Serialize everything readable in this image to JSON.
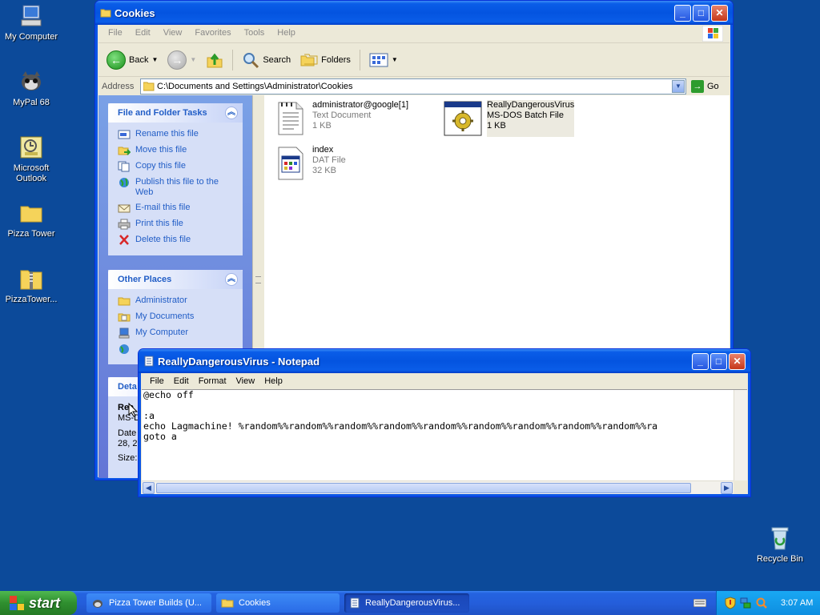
{
  "desktop": {
    "icons": [
      {
        "label": "My Computer"
      },
      {
        "label": "MyPal 68"
      },
      {
        "label": "Microsoft Outlook"
      },
      {
        "label": "Pizza Tower"
      },
      {
        "label": "PizzaTower..."
      },
      {
        "label": "Recycle Bin"
      }
    ]
  },
  "explorer": {
    "title": "Cookies",
    "menu": [
      "File",
      "Edit",
      "View",
      "Favorites",
      "Tools",
      "Help"
    ],
    "toolbar": {
      "back": "Back",
      "search": "Search",
      "folders": "Folders"
    },
    "address": {
      "label": "Address",
      "value": "C:\\Documents and Settings\\Administrator\\Cookies",
      "go": "Go"
    },
    "tasks": {
      "title": "File and Folder Tasks",
      "items": [
        "Rename this file",
        "Move this file",
        "Copy this file",
        "Publish this file to the Web",
        "E-mail this file",
        "Print this file",
        "Delete this file"
      ]
    },
    "places": {
      "title": "Other Places",
      "items": [
        "Administrator",
        "My Documents",
        "My Computer"
      ]
    },
    "details": {
      "title": "Deta",
      "name": "Rea",
      "type": "MS-D",
      "date_label": "Date",
      "date_value": "28, 2",
      "size_label": "Size:"
    },
    "files": [
      {
        "name": "administrator@google[1]",
        "type": "Text Document",
        "size": "1 KB"
      },
      {
        "name": "ReallyDangerousVirus",
        "type": "MS-DOS Batch File",
        "size": "1 KB"
      },
      {
        "name": "index",
        "type": "DAT File",
        "size": "32 KB"
      }
    ]
  },
  "notepad": {
    "title": "ReallyDangerousVirus - Notepad",
    "menu": [
      "File",
      "Edit",
      "Format",
      "View",
      "Help"
    ],
    "lines": [
      "@echo off",
      "",
      ":a",
      "echo Lagmachine! %random%%random%%random%%random%%random%%random%%random%%random%%random%%ra",
      "goto a"
    ]
  },
  "taskbar": {
    "start": "start",
    "buttons": [
      "Pizza Tower Builds (U...",
      "Cookies",
      "ReallyDangerousVirus..."
    ],
    "clock": "3:07 AM"
  }
}
